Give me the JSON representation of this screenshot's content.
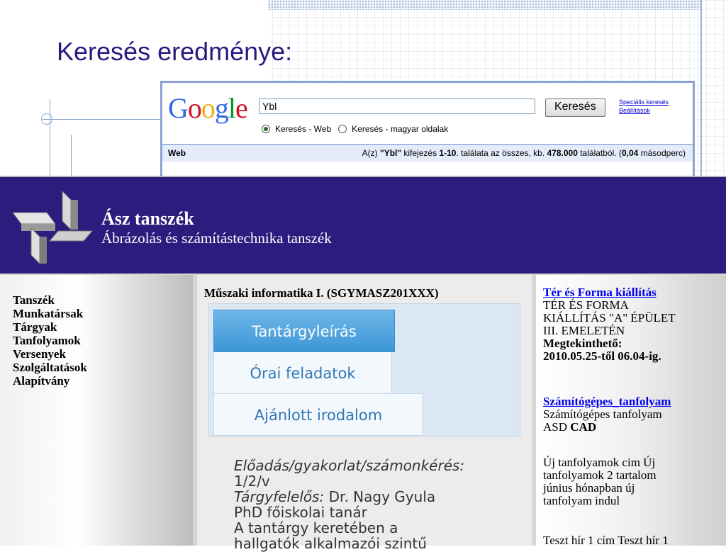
{
  "slide": {
    "title": "Keresés eredménye:"
  },
  "google": {
    "logo": "Google",
    "query": "Ybl",
    "search_button": "Keresés",
    "links": [
      "Speciális keresés",
      "Beállítások"
    ],
    "radio_web": "Keresés - Web",
    "radio_hu": "Keresés - magyar oldalak",
    "bar_label": "Web",
    "stats_prefix": "A(z) ",
    "stats_term": "\"Ybl\"",
    "stats_mid": " kifejezés ",
    "stats_range": "1-10",
    "stats_mid2": ". találata az összes, kb. ",
    "stats_total": "478.000",
    "stats_mid3": " találatból. (",
    "stats_time": "0,04",
    "stats_end": " másodperc)",
    "colors": {
      "frame": "#8aa2d1",
      "bar": "#e5ecf9"
    }
  },
  "site": {
    "name": "Ász tanszék",
    "subtitle": "Ábrázolás és számítástechnika tanszék",
    "header_color": "#2d1b7e",
    "nav": [
      "Tanszék",
      "Munkatársak",
      "Tárgyak",
      "Tanfolyamok",
      "Versenyek",
      "Szolgáltatások",
      "Alapítvány"
    ],
    "course_title": "Műszaki informatika I. (SGYMASZ201XXX)",
    "tabs": [
      "Tantárgyleírás",
      "Órai feladatok",
      "Ajánlott irodalom"
    ],
    "desc": {
      "l1_label": "Előadás/gyakorlat/számonkérés:",
      "l2": "1/2/v",
      "l3_label": "Tárgyfelelős:",
      "l3_value": " Dr. Nagy Gyula",
      "l4": "PhD főiskolai tanár",
      "l5": "A tantárgy keretében a",
      "l6": "hallgatók alkalmazói szintű"
    },
    "news": [
      {
        "link": "Tér és Forma kiállítás",
        "lines": [
          "TÉR ÉS FORMA",
          "KIÁLLÍTÁS \"A\" ÉPÜLET",
          "III. EMELETÉN"
        ],
        "bold1": "Megtekinthető:",
        "bold2": "2010.05.25-től 06.04-ig."
      },
      {
        "link": "Számítógépes_tanfolyam",
        "line1": "Számítógépes tanfolyam",
        "line2a": "ASD ",
        "line2b": "CAD"
      },
      {
        "lines": [
          "Új tanfolyamok cim Új",
          "tanfolyamok 2 tartalom",
          "június hónapban új",
          "tanfolyam indul"
        ]
      },
      {
        "line": "Teszt hír 1 cím Teszt hír 1"
      }
    ]
  }
}
